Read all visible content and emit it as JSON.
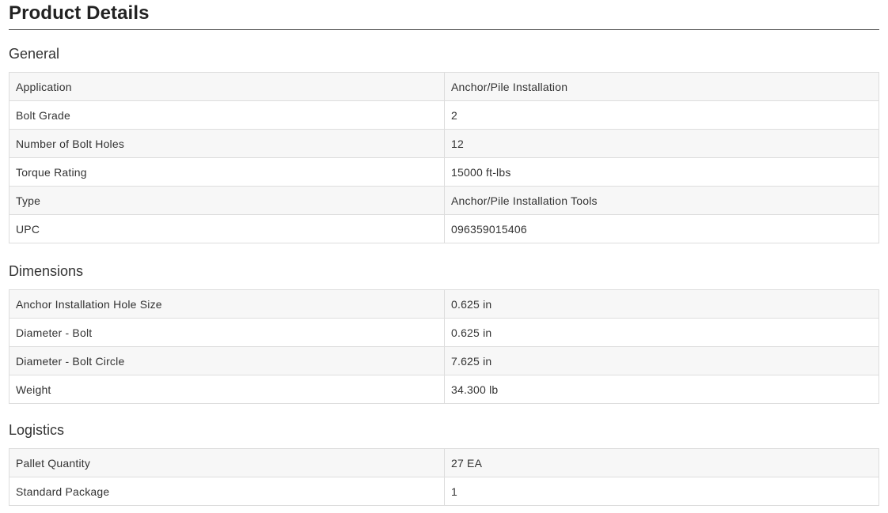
{
  "page": {
    "title": "Product Details"
  },
  "sections": [
    {
      "heading": "General",
      "rows": [
        {
          "label": "Application",
          "value": "Anchor/Pile Installation"
        },
        {
          "label": "Bolt Grade",
          "value": "2"
        },
        {
          "label": "Number of Bolt Holes",
          "value": "12"
        },
        {
          "label": "Torque Rating",
          "value": "15000 ft-lbs"
        },
        {
          "label": "Type",
          "value": "Anchor/Pile Installation Tools"
        },
        {
          "label": "UPC",
          "value": "096359015406"
        }
      ]
    },
    {
      "heading": "Dimensions",
      "rows": [
        {
          "label": "Anchor Installation Hole Size",
          "value": "0.625 in"
        },
        {
          "label": "Diameter - Bolt",
          "value": "0.625 in"
        },
        {
          "label": "Diameter - Bolt Circle",
          "value": "7.625 in"
        },
        {
          "label": "Weight",
          "value": "34.300 lb"
        }
      ]
    },
    {
      "heading": "Logistics",
      "rows": [
        {
          "label": "Pallet Quantity",
          "value": "27 EA"
        },
        {
          "label": "Standard Package",
          "value": "1"
        }
      ]
    }
  ]
}
